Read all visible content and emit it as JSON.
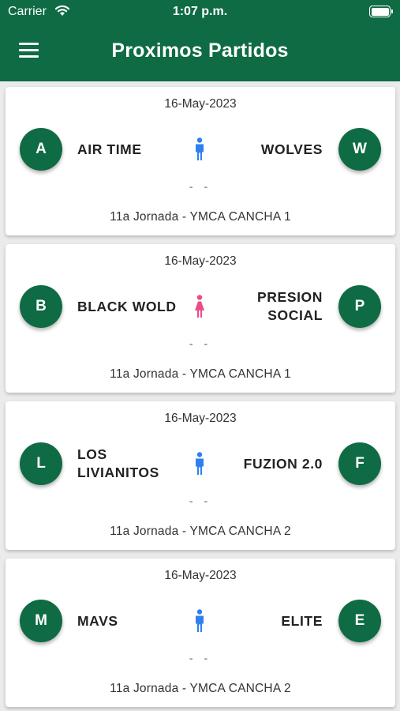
{
  "status_bar": {
    "carrier": "Carrier",
    "time": "1:07 p.m."
  },
  "header": {
    "title": "Proximos Partidos",
    "menu_icon": "hamburger-menu-icon"
  },
  "colors": {
    "brand_green": "#0e6b44",
    "male_blue": "#2f80ed",
    "female_pink": "#ea4c89",
    "background": "#ebebeb"
  },
  "matches": [
    {
      "date": "16-May-2023",
      "home": {
        "initial": "A",
        "name": "AIR TIME"
      },
      "away": {
        "initial": "W",
        "name": "WOLVES"
      },
      "gender_icon": "male-icon",
      "score": "- -",
      "venue": "11a Jornada - YMCA CANCHA 1"
    },
    {
      "date": "16-May-2023",
      "home": {
        "initial": "B",
        "name": "BLACK WOLD"
      },
      "away": {
        "initial": "P",
        "name": "PRESION SOCIAL"
      },
      "gender_icon": "female-icon",
      "score": "- -",
      "venue": "11a Jornada - YMCA CANCHA 1"
    },
    {
      "date": "16-May-2023",
      "home": {
        "initial": "L",
        "name": "LOS LIVIANITOS"
      },
      "away": {
        "initial": "F",
        "name": "FUZION 2.0"
      },
      "gender_icon": "male-icon",
      "score": "- -",
      "venue": "11a Jornada - YMCA CANCHA 2"
    },
    {
      "date": "16-May-2023",
      "home": {
        "initial": "M",
        "name": "MAVS"
      },
      "away": {
        "initial": "E",
        "name": "ELITE"
      },
      "gender_icon": "male-icon",
      "score": "- -",
      "venue": "11a Jornada - YMCA CANCHA 2"
    }
  ]
}
